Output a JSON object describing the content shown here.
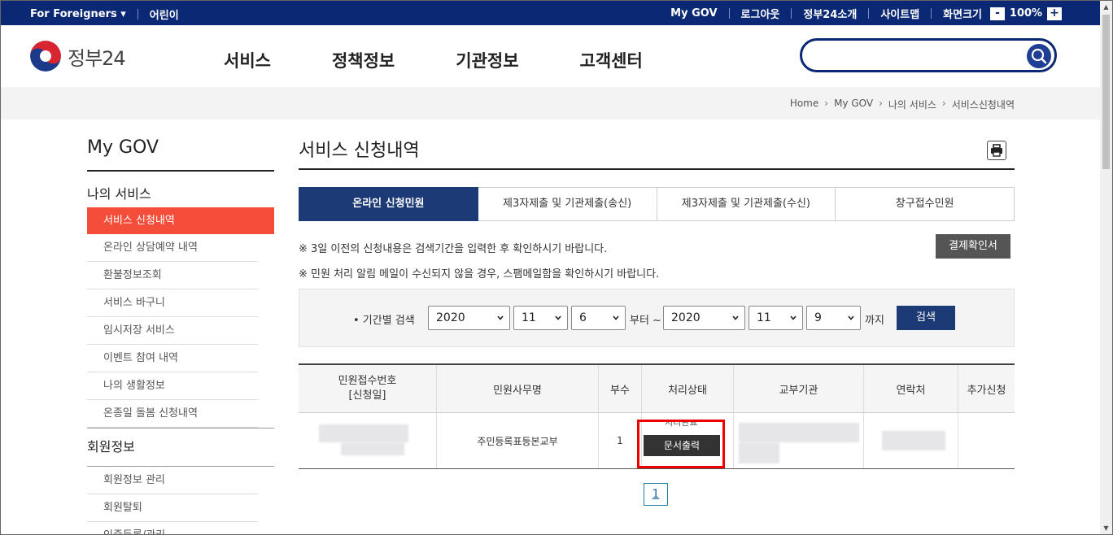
{
  "topbar": {
    "for_foreigners": "For Foreigners ▾",
    "kids": "어린이",
    "my_gov": "My GOV",
    "logout": "로그아웃",
    "about": "정부24소개",
    "sitemap": "사이트맵",
    "screen_size": "화면크기",
    "zoom_minus": "-",
    "zoom_value": "100%",
    "zoom_plus": "+"
  },
  "header": {
    "logo_text": "정부24",
    "gnb": [
      "서비스",
      "정책정보",
      "기관정보",
      "고객센터"
    ],
    "search_placeholder": ""
  },
  "breadcrumb": [
    "Home",
    "My GOV",
    "나의 서비스",
    "서비스신청내역"
  ],
  "lnb": {
    "title": "My GOV",
    "section1": "나의 서비스",
    "active_item": "서비스 신청내역",
    "items": [
      "온라인 상담예약 내역",
      "환불정보조회",
      "서비스 바구니",
      "임시저장 서비스",
      "이벤트 참여 내역",
      "나의 생활정보",
      "온종일 돌봄 신청내역"
    ],
    "section2": "회원정보",
    "items2": [
      "회원정보 관리",
      "회원탈퇴",
      "인증등록/관리"
    ]
  },
  "content": {
    "title": "서비스 신청내역",
    "tabs": [
      "온라인 신청민원",
      "제3자제출 및 기관제출(송신)",
      "제3자제출 및 기관제출(수신)",
      "창구접수민원"
    ],
    "note1": "※ 3일 이전의 신청내용은 검색기간을 입력한 후 확인하시기 바랍니다.",
    "note2": "※ 민원 처리 알림 메일이 수신되지 않을 경우, 스팸메일함을 확인하시기 바랍니다.",
    "pay_button": "결제확인서",
    "search": {
      "label": "• 기간별 검색",
      "from_year": "2020",
      "from_month": "11",
      "from_day": "6",
      "from_text": "부터 ~",
      "to_year": "2020",
      "to_month": "11",
      "to_day": "9",
      "to_text": "까지",
      "button": "검색"
    },
    "table": {
      "headers": [
        "민원접수번호\n[신청일]",
        "민원사무명",
        "부수",
        "처리상태",
        "교부기관",
        "연락처",
        "추가신청"
      ],
      "row": {
        "service": "주민등록표등본교부",
        "count": "1",
        "status": "처리완료",
        "doc_button": "문서출력"
      }
    },
    "pager": "1"
  }
}
